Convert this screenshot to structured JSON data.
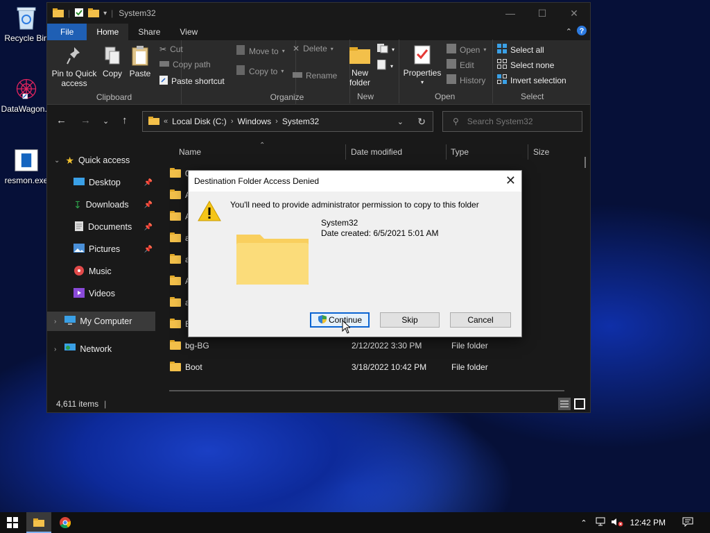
{
  "desktop": {
    "icons": [
      {
        "label": "Recycle Bin"
      },
      {
        "label": "DataWagon..."
      },
      {
        "label": "resmon.exe"
      }
    ]
  },
  "window": {
    "title": "System32",
    "tabs": {
      "file": "File",
      "home": "Home",
      "share": "Share",
      "view": "View"
    },
    "ribbon": {
      "clipboard": {
        "pin": "Pin to Quick access",
        "copy": "Copy",
        "paste": "Paste",
        "cut": "Cut",
        "copy_path": "Copy path",
        "paste_shortcut": "Paste shortcut",
        "label": "Clipboard"
      },
      "organize": {
        "move_to": "Move to",
        "copy_to": "Copy to",
        "delete": "Delete",
        "rename": "Rename",
        "label": "Organize"
      },
      "new": {
        "new_folder": "New folder",
        "label": "New"
      },
      "open": {
        "properties": "Properties",
        "open": "Open",
        "edit": "Edit",
        "history": "History",
        "label": "Open"
      },
      "select": {
        "select_all": "Select all",
        "select_none": "Select none",
        "invert": "Invert selection",
        "label": "Select"
      }
    },
    "address": {
      "crumbs": [
        "Local Disk (C:)",
        "Windows",
        "System32"
      ]
    },
    "search": {
      "placeholder": "Search System32"
    },
    "nav": {
      "quick_access": "Quick access",
      "items": [
        "Desktop",
        "Downloads",
        "Documents",
        "Pictures",
        "Music",
        "Videos"
      ],
      "my_computer": "My Computer",
      "network": "Network"
    },
    "columns": {
      "name": "Name",
      "date": "Date modified",
      "type": "Type",
      "size": "Size"
    },
    "files": [
      {
        "name": "0"
      },
      {
        "name": "A"
      },
      {
        "name": "A"
      },
      {
        "name": "a"
      },
      {
        "name": "a"
      },
      {
        "name": "A"
      },
      {
        "name": "a"
      },
      {
        "name": "B"
      },
      {
        "name": "bg-BG",
        "date": "2/12/2022 3:30 PM",
        "type": "File folder"
      },
      {
        "name": "Boot",
        "date": "3/18/2022 10:42 PM",
        "type": "File folder"
      }
    ],
    "status": {
      "items": "4,611 items"
    }
  },
  "dialog": {
    "title": "Destination Folder Access Denied",
    "message": "You'll need to provide administrator permission to copy to this folder",
    "folder_name": "System32",
    "folder_date": "Date created: 6/5/2021 5:01 AM",
    "continue": "Continue",
    "skip": "Skip",
    "cancel": "Cancel"
  },
  "taskbar": {
    "time": "12:42 PM"
  },
  "colors": {
    "file_tab": "#1f5fb4",
    "folder": "#f3c04a",
    "dialog_default": "#0a64d2"
  }
}
